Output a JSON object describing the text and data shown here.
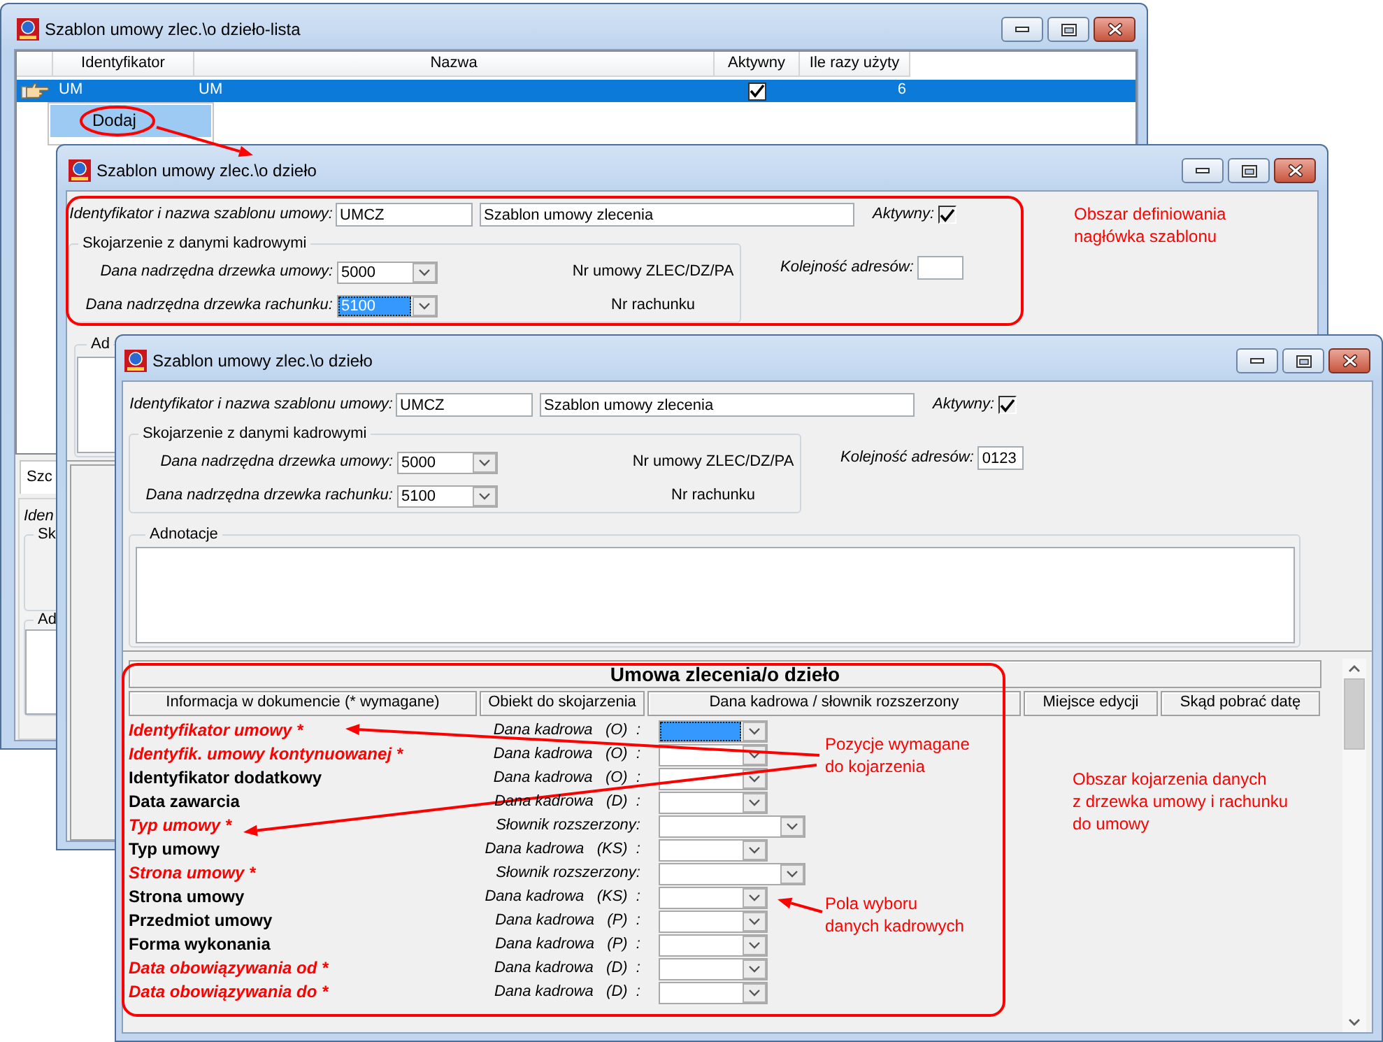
{
  "list_window": {
    "title": "Szablon umowy zlec.\\o dzieło-lista",
    "columns": [
      "Identyfikator",
      "Nazwa",
      "Aktywny",
      "Ile razy użyty"
    ],
    "rows": [
      {
        "selected": true,
        "id": "UM",
        "name": "UM",
        "active": true,
        "uses": "6"
      }
    ],
    "context_menu": [
      {
        "label": "Dodaj",
        "selected": true
      }
    ],
    "tabs": [
      {
        "label": "Szc",
        "selected": true
      }
    ],
    "field_label": "Iden",
    "groups": [
      "Sk",
      "Ad"
    ]
  },
  "dialog_windows": [
    {
      "title": "Szablon umowy zlec.\\o dzieło",
      "id_label": "Identyfikator i nazwa szablonu umowy:",
      "id_value": "UMCZ",
      "name_value": "Szablon umowy zlecenia",
      "active_label": "Aktywny:",
      "active": true,
      "link_group": {
        "title": "Skojarzenie z danymi kadrowymi",
        "fields": [
          {
            "label": "Dana nadrzędna drzewka umowy:",
            "value": "5000",
            "note": "Nr umowy ZLEC/DZ/PA",
            "focused": false
          },
          {
            "label": "Dana nadrzędna drzewka rachunku:",
            "value": "5100",
            "note": "Nr rachunku",
            "focused": true
          }
        ]
      },
      "order_label": "Kolejność adresów:",
      "notes_label": "Ad"
    },
    {
      "title": "Szablon umowy zlec.\\o dzieło",
      "id_label": "Identyfikator i nazwa szablonu umowy:",
      "id_value": "UMCZ",
      "name_value": "Szablon umowy zlecenia",
      "active_label": "Aktywny:",
      "active": true,
      "link_group": {
        "title": "Skojarzenie z danymi kadrowymi",
        "fields": [
          {
            "label": "Dana nadrzędna drzewka umowy:",
            "value": "5000",
            "note": "Nr umowy ZLEC/DZ/PA",
            "focused": false
          },
          {
            "label": "Dana nadrzędna drzewka rachunku:",
            "value": "5100",
            "note": "Nr rachunku",
            "focused": false
          }
        ]
      },
      "order_label": "Kolejność adresów:",
      "order_value": "0123",
      "notes_label": "Adnotacje",
      "mapping_table": {
        "title": "Umowa zlecenia/o dzieło",
        "columns": [
          "Informacja w dokumencie (* wymagane)",
          "Obiekt do skojarzenia",
          "Dana kadrowa / słownik rozszerzony",
          "Miejsce edycji",
          "Skąd pobrać datę"
        ],
        "rows": [
          {
            "label": "Identyfikator umowy *",
            "required": true,
            "object": "Dana kadrowa   (O)  :",
            "kind": "staff",
            "focused": true
          },
          {
            "label": "Identyfik. umowy kontynuowanej *",
            "required": true,
            "object": "Dana kadrowa   (O)  :",
            "kind": "staff",
            "focused": false
          },
          {
            "label": "Identyfikator dodatkowy",
            "required": false,
            "object": "Dana kadrowa   (O)  :",
            "kind": "staff",
            "focused": false
          },
          {
            "label": "Data zawarcia",
            "required": false,
            "object": "Dana kadrowa   (D)  :",
            "kind": "staff",
            "focused": false
          },
          {
            "label": "Typ umowy *",
            "required": true,
            "object": "Słownik rozszerzony:",
            "kind": "dictionary",
            "focused": false
          },
          {
            "label": "Typ umowy",
            "required": false,
            "object": "Dana kadrowa   (KS)  :",
            "kind": "staff",
            "focused": false
          },
          {
            "label": "Strona umowy *",
            "required": true,
            "object": "Słownik rozszerzony:",
            "kind": "dictionary",
            "focused": false
          },
          {
            "label": "Strona umowy",
            "required": false,
            "object": "Dana kadrowa   (KS)  :",
            "kind": "staff",
            "focused": false
          },
          {
            "label": "Przedmiot umowy",
            "required": false,
            "object": "Dana kadrowa   (P)  :",
            "kind": "staff",
            "focused": false
          },
          {
            "label": "Forma wykonania",
            "required": false,
            "object": "Dana kadrowa   (P)  :",
            "kind": "staff",
            "focused": false
          },
          {
            "label": "Data obowiązywania od *",
            "required": true,
            "object": "Dana kadrowa   (D)  :",
            "kind": "staff",
            "focused": false
          },
          {
            "label": "Data obowiązywania do *",
            "required": true,
            "object": "Dana kadrowa   (D)  :",
            "kind": "staff",
            "focused": false
          }
        ]
      }
    }
  ],
  "annotations": [
    {
      "lines": [
        "Obszar definiowania",
        "nagłówka szablonu"
      ]
    },
    {
      "lines": [
        "Pozycje wymagane",
        "do kojarzenia"
      ]
    },
    {
      "lines": [
        "Obszar kojarzenia danych",
        "z drzewka umowy i rachunku",
        "do umowy"
      ]
    },
    {
      "lines": [
        "Pola wyboru",
        "danych kadrowych"
      ]
    }
  ]
}
